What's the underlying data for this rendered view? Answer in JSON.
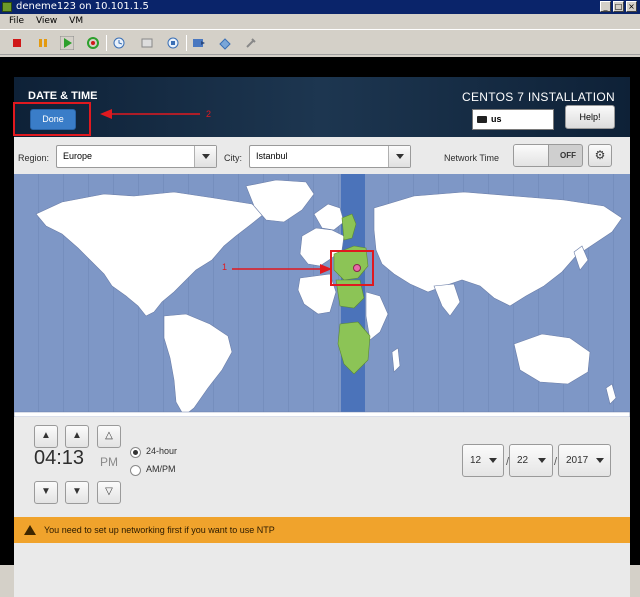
{
  "window": {
    "title": "deneme123 on 10.101.1.5",
    "menu": [
      "File",
      "View",
      "VM"
    ],
    "toolbar_icons": [
      "stop-icon",
      "pause-icon",
      "play-icon",
      "reset-icon",
      "snapshot-icon",
      "revert-snapshot-icon",
      "manage-snapshot-icon",
      "cd-icon",
      "floppy-icon",
      "settings-icon"
    ]
  },
  "installer": {
    "section_title": "DATE & TIME",
    "product_title": "CENTOS 7 INSTALLATION",
    "done_label": "Done",
    "keyboard_layout": "us",
    "help_label": "Help!",
    "region_label": "Region:",
    "region_value": "Europe",
    "city_label": "City:",
    "city_value": "Istanbul",
    "network_time_label": "Network Time",
    "network_time_state": "OFF",
    "time": {
      "value": "04:13",
      "ampm": "PM",
      "format_24": "24-hour",
      "format_ampm": "AM/PM",
      "selected_format": "24-hour"
    },
    "date": {
      "month": "12",
      "day": "22",
      "year": "2017",
      "separator": "/"
    },
    "warning": "You need to set up networking first if you want to use NTP"
  },
  "annotations": [
    {
      "number": "1"
    },
    {
      "number": "2"
    }
  ],
  "colors": {
    "header_bg": "#0e2137",
    "done_button": "#3a7dc8",
    "map_ocean": "#7e97c6",
    "land": "#ffffff",
    "selected_timezone_land": "#8cc456",
    "selected_timezone_stripe": "#4b73ba",
    "warning_bar": "#f0a32c",
    "annotation_red": "#e0191f"
  }
}
